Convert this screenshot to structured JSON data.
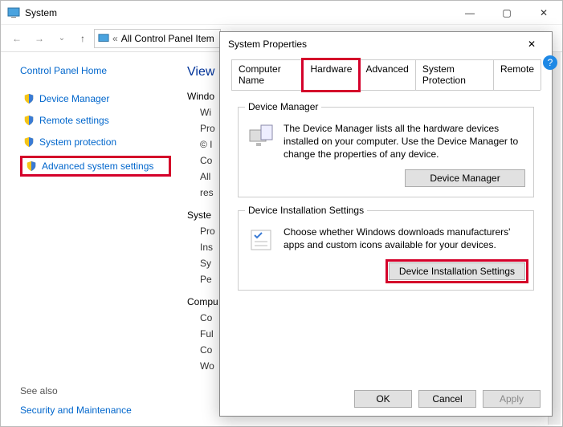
{
  "window": {
    "title": "System",
    "minimize": "—",
    "maximize": "▢",
    "close": "✕"
  },
  "nav": {
    "back": "←",
    "forward": "→",
    "recent": "⌄",
    "up": "↑",
    "address_text": "All Control Panel Item",
    "refresh": "⟳"
  },
  "sidebar": {
    "home": "Control Panel Home",
    "items": [
      "Device Manager",
      "Remote settings",
      "System protection",
      "Advanced system settings"
    ],
    "see_also_label": "See also",
    "see_also_link": "Security and Maintenance"
  },
  "main": {
    "heading": "View",
    "section_windows": "Windo",
    "rows_a": [
      "Wi",
      "Pro",
      "© I",
      "Co",
      "All",
      "res"
    ],
    "section_system": "Syste",
    "rows_b": [
      "Pro",
      "Ins",
      "Sy",
      "Pe"
    ],
    "section_computer": "Compu",
    "rows_c": [
      "Co",
      "Ful",
      "Co",
      "Wo"
    ]
  },
  "dialog": {
    "title": "System Properties",
    "close": "✕",
    "tabs": [
      "Computer Name",
      "Hardware",
      "Advanced",
      "System Protection",
      "Remote"
    ],
    "active_tab_index": 1,
    "group1": {
      "title": "Device Manager",
      "text": "The Device Manager lists all the hardware devices installed on your computer. Use the Device Manager to change the properties of any device.",
      "button": "Device Manager"
    },
    "group2": {
      "title": "Device Installation Settings",
      "text": "Choose whether Windows downloads manufacturers' apps and custom icons available for your devices.",
      "button": "Device Installation Settings"
    },
    "footer": {
      "ok": "OK",
      "cancel": "Cancel",
      "apply": "Apply"
    }
  },
  "help_icon": "?"
}
